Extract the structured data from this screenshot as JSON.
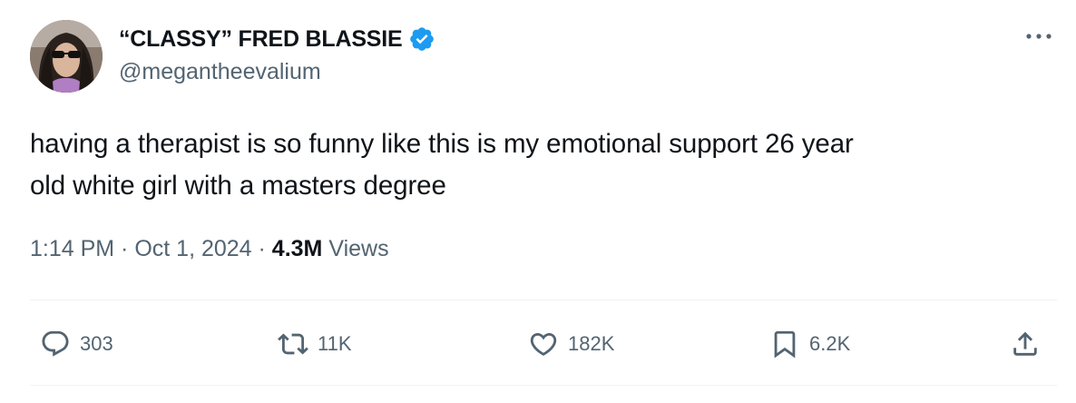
{
  "user": {
    "display_name": "“CLASSY” FRED BLASSIE",
    "handle": "@megantheevalium",
    "verified": true,
    "avatar": "profile-photo"
  },
  "tweet": {
    "text": "having a therapist is so funny like this is my emotional support 26 year\nold white girl with a masters degree",
    "time": "1:14 PM",
    "separator": " · ",
    "date": "Oct 1, 2024",
    "views_count": "4.3M",
    "views_label": "Views"
  },
  "actions": {
    "replies": "303",
    "retweets": "11K",
    "likes": "182K",
    "bookmarks": "6.2K"
  },
  "icons": {
    "more": "more-horizontal-icon",
    "verified": "verified-badge-icon",
    "reply": "reply-icon",
    "retweet": "retweet-icon",
    "like": "heart-icon",
    "bookmark": "bookmark-icon",
    "share": "share-icon"
  },
  "colors": {
    "text": "#0f1419",
    "secondary": "#536471",
    "verified": "#1d9bf0",
    "divider": "#eff3f4"
  }
}
